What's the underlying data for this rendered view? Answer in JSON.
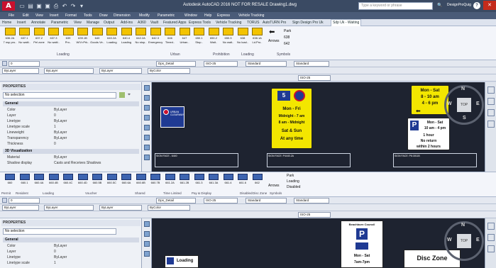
{
  "titlebar": {
    "logo": "A",
    "title": "Autodesk AutoCAD 2016   NOT FOR RESALE   Drawing1.dwg",
    "search_placeholder": "Type a keyword or phrase",
    "user": "DesignProQuig",
    "help": "?"
  },
  "menu": [
    "File",
    "Edit",
    "View",
    "Insert",
    "Format",
    "Tools",
    "Draw",
    "Dimension",
    "Modify",
    "Parametric",
    "Window",
    "Help",
    "Express",
    "Vehicle Tracking"
  ],
  "tabs": [
    "Home",
    "Insert",
    "Annotate",
    "Parametric",
    "View",
    "Manage",
    "Output",
    "Add-ins",
    "A360",
    "Vault",
    "Featured Apps",
    "Express Tools",
    "Vehicle Tracking",
    "TORUS",
    "AutoTURN Pro",
    "Sign Design Pro Uk",
    "Sdp Uk - Waiting"
  ],
  "active_tab": "Sdp Uk - Waiting",
  "ribbon1": {
    "buttons": [
      {
        "code": "636.2A",
        "desc": "7 nsp pro.."
      },
      {
        "code": "637.1",
        "desc": "No waiti.."
      },
      {
        "code": "637.2",
        "desc": "Pel zone"
      },
      {
        "code": "637.3",
        "desc": "No waiti.."
      },
      {
        "code": "639",
        "desc": "Pro.."
      },
      {
        "code": "639.1B",
        "desc": "W/V>Prk.."
      },
      {
        "code": "640",
        "desc": "Goods Ve.."
      },
      {
        "code": "640.2A",
        "desc": "Loading"
      },
      {
        "code": "640.4",
        "desc": "Loading"
      },
      {
        "code": "642.2A",
        "desc": "No stop.."
      },
      {
        "code": "642.3",
        "desc": "Emergency"
      },
      {
        "code": "646",
        "desc": "Timed.."
      },
      {
        "code": "647",
        "desc": "Urban.."
      },
      {
        "code": "650.1",
        "desc": "Stop.."
      },
      {
        "code": "650.2",
        "desc": "Wait.."
      },
      {
        "code": "650.3",
        "desc": "No wait.."
      },
      {
        "code": "638",
        "desc": "No load.."
      },
      {
        "code": "638.1A",
        "desc": "Ld.Pro.."
      }
    ],
    "arrows": "Arrows",
    "side": [
      "Park",
      "638",
      "642"
    ],
    "sections": [
      "Loading",
      "Urban",
      "Prohibition",
      "Loading",
      "Symbols"
    ]
  },
  "toolbar": {
    "layer": "0",
    "style": "Dps_Detail",
    "iso": "ISO-25",
    "text": "Standard",
    "table": "Standard",
    "bylayer1": "ByLayer",
    "bylayer2": "ByLayer",
    "bylayer3": "ByLayer",
    "bycolor": "ByColor",
    "iso2": "ISO-25"
  },
  "properties": {
    "title": "PROPERTIES",
    "selection": "No selection",
    "general": "General",
    "rows": [
      {
        "k": "Color",
        "v": "ByLayer"
      },
      {
        "k": "Layer",
        "v": "0"
      },
      {
        "k": "Linetype",
        "v": "ByLayer"
      },
      {
        "k": "Linetype scale",
        "v": "1"
      },
      {
        "k": "Lineweight",
        "v": "ByLayer"
      },
      {
        "k": "Transparency",
        "v": "ByLayer"
      },
      {
        "k": "Thickness",
        "v": "0"
      }
    ],
    "view3d": "3D Visualization",
    "rows3d": [
      {
        "k": "Material",
        "v": "ByLayer"
      },
      {
        "k": "Shadow display",
        "v": "Casts and Receives Shadows"
      }
    ]
  },
  "canvas1": {
    "sign_a": {
      "line1": "Mon - Fri",
      "line2": "Midnight - 7 am",
      "line3": "8 am - Midnight",
      "line4": "Sat & Sun",
      "line5": "At any time",
      "badge": "5"
    },
    "sign_b": {
      "line1": "Mon - Sat",
      "line2": "8 - 10 am",
      "line3": "4 - 6 pm"
    },
    "sign_c": {
      "line1": "Mon - Sat",
      "line2": "10 am - 4 pm",
      "line3": "1 hour",
      "line4": "No return",
      "line5": "within 2 hours"
    },
    "panel_labels": [
      "SIGN FACE - 6440",
      "SIGN FACE: P4440.2A",
      "SIGN FACE: P6:3011B"
    ],
    "small_sign": "URBAN CLEARWAY",
    "compass": {
      "n": "N",
      "s": "S",
      "e": "E",
      "w": "W",
      "top": "TOP"
    }
  },
  "ribbon2": {
    "codes": [
      "660",
      "660.1",
      "660.4A",
      "660.4B",
      "660.4C",
      "660.4D",
      "660.5B",
      "660.5C",
      "660.6A",
      "660.6B",
      "660.7B",
      "661.2A",
      "661.2B",
      "661.3",
      "661.3A",
      "661.4",
      "661.6",
      "662"
    ],
    "arrows": "Arrows",
    "side": [
      "Park",
      "Loading",
      "Disabled"
    ],
    "sections": [
      "Permit",
      "Resident",
      "Loading",
      "Voucher",
      "Shared",
      "Time Limited",
      "Pay & Display",
      "Disabled",
      "Disc Zone",
      "Symbols"
    ]
  },
  "canvas2": {
    "council": "Beachburn Council",
    "p": "P",
    "sign_a": {
      "line1": "Mon - Sat",
      "line2": "7am-7pm"
    },
    "loading": "Loading",
    "disc": "Disc Zone"
  }
}
